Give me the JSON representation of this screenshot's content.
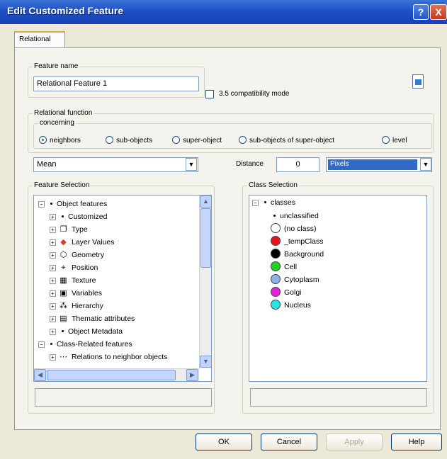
{
  "window": {
    "title": "Edit Customized Feature",
    "help_glyph": "?",
    "close_glyph": "X"
  },
  "tab": {
    "label": "Relational"
  },
  "feature_name": {
    "group_label": "Feature name",
    "value": "Relational Feature 1",
    "compat_label": "3.5 compatibility mode",
    "compat_checked": false
  },
  "relational_function": {
    "group_label": "Relational function",
    "concerning_label": "concerning",
    "options": [
      {
        "label": "neighbors",
        "selected": true
      },
      {
        "label": "sub-objects",
        "selected": false
      },
      {
        "label": "super-object",
        "selected": false
      },
      {
        "label": "sub-objects of super-object",
        "selected": false
      },
      {
        "label": "level",
        "selected": false
      }
    ],
    "function_value": "Mean",
    "distance_label": "Distance",
    "distance_value": "0",
    "unit_value": "Pixels"
  },
  "feature_selection": {
    "label": "Feature Selection",
    "items": [
      {
        "label": "Object features",
        "icon": "dot",
        "level": 0,
        "expander": "−"
      },
      {
        "label": "Customized",
        "icon": "dot",
        "level": 1,
        "expander": "+"
      },
      {
        "label": "Type",
        "icon": "type-icon",
        "level": 1,
        "expander": "+"
      },
      {
        "label": "Layer Values",
        "icon": "layer-values-icon",
        "level": 1,
        "expander": "+"
      },
      {
        "label": "Geometry",
        "icon": "geometry-icon",
        "level": 1,
        "expander": "+"
      },
      {
        "label": "Position",
        "icon": "position-icon",
        "level": 1,
        "expander": "+"
      },
      {
        "label": "Texture",
        "icon": "texture-icon",
        "level": 1,
        "expander": "+"
      },
      {
        "label": "Variables",
        "icon": "variables-icon",
        "level": 1,
        "expander": "+"
      },
      {
        "label": "Hierarchy",
        "icon": "hierarchy-icon",
        "level": 1,
        "expander": "+"
      },
      {
        "label": "Thematic attributes",
        "icon": "thematic-icon",
        "level": 1,
        "expander": "+"
      },
      {
        "label": "Object Metadata",
        "icon": "dot",
        "level": 1,
        "expander": "+"
      },
      {
        "label": "Class-Related features",
        "icon": "dot",
        "level": 0,
        "expander": "−"
      },
      {
        "label": "Relations to neighbor objects",
        "icon": "relations-icon",
        "level": 1,
        "expander": "+"
      }
    ]
  },
  "class_selection": {
    "label": "Class Selection",
    "root": "classes",
    "items": [
      {
        "label": "unclassified",
        "color": null
      },
      {
        "label": "(no class)",
        "color": "#ffffff"
      },
      {
        "label": "_tempClass",
        "color": "#e8141b"
      },
      {
        "label": "Background",
        "color": "#000000"
      },
      {
        "label": "Cell",
        "color": "#1fd41f"
      },
      {
        "label": "Cytoplasm",
        "color": "#8fb0e6"
      },
      {
        "label": "Golgi",
        "color": "#e61ee0"
      },
      {
        "label": "Nucleus",
        "color": "#25e8e4"
      }
    ]
  },
  "buttons": {
    "ok": "OK",
    "cancel": "Cancel",
    "apply": "Apply",
    "help": "Help"
  }
}
